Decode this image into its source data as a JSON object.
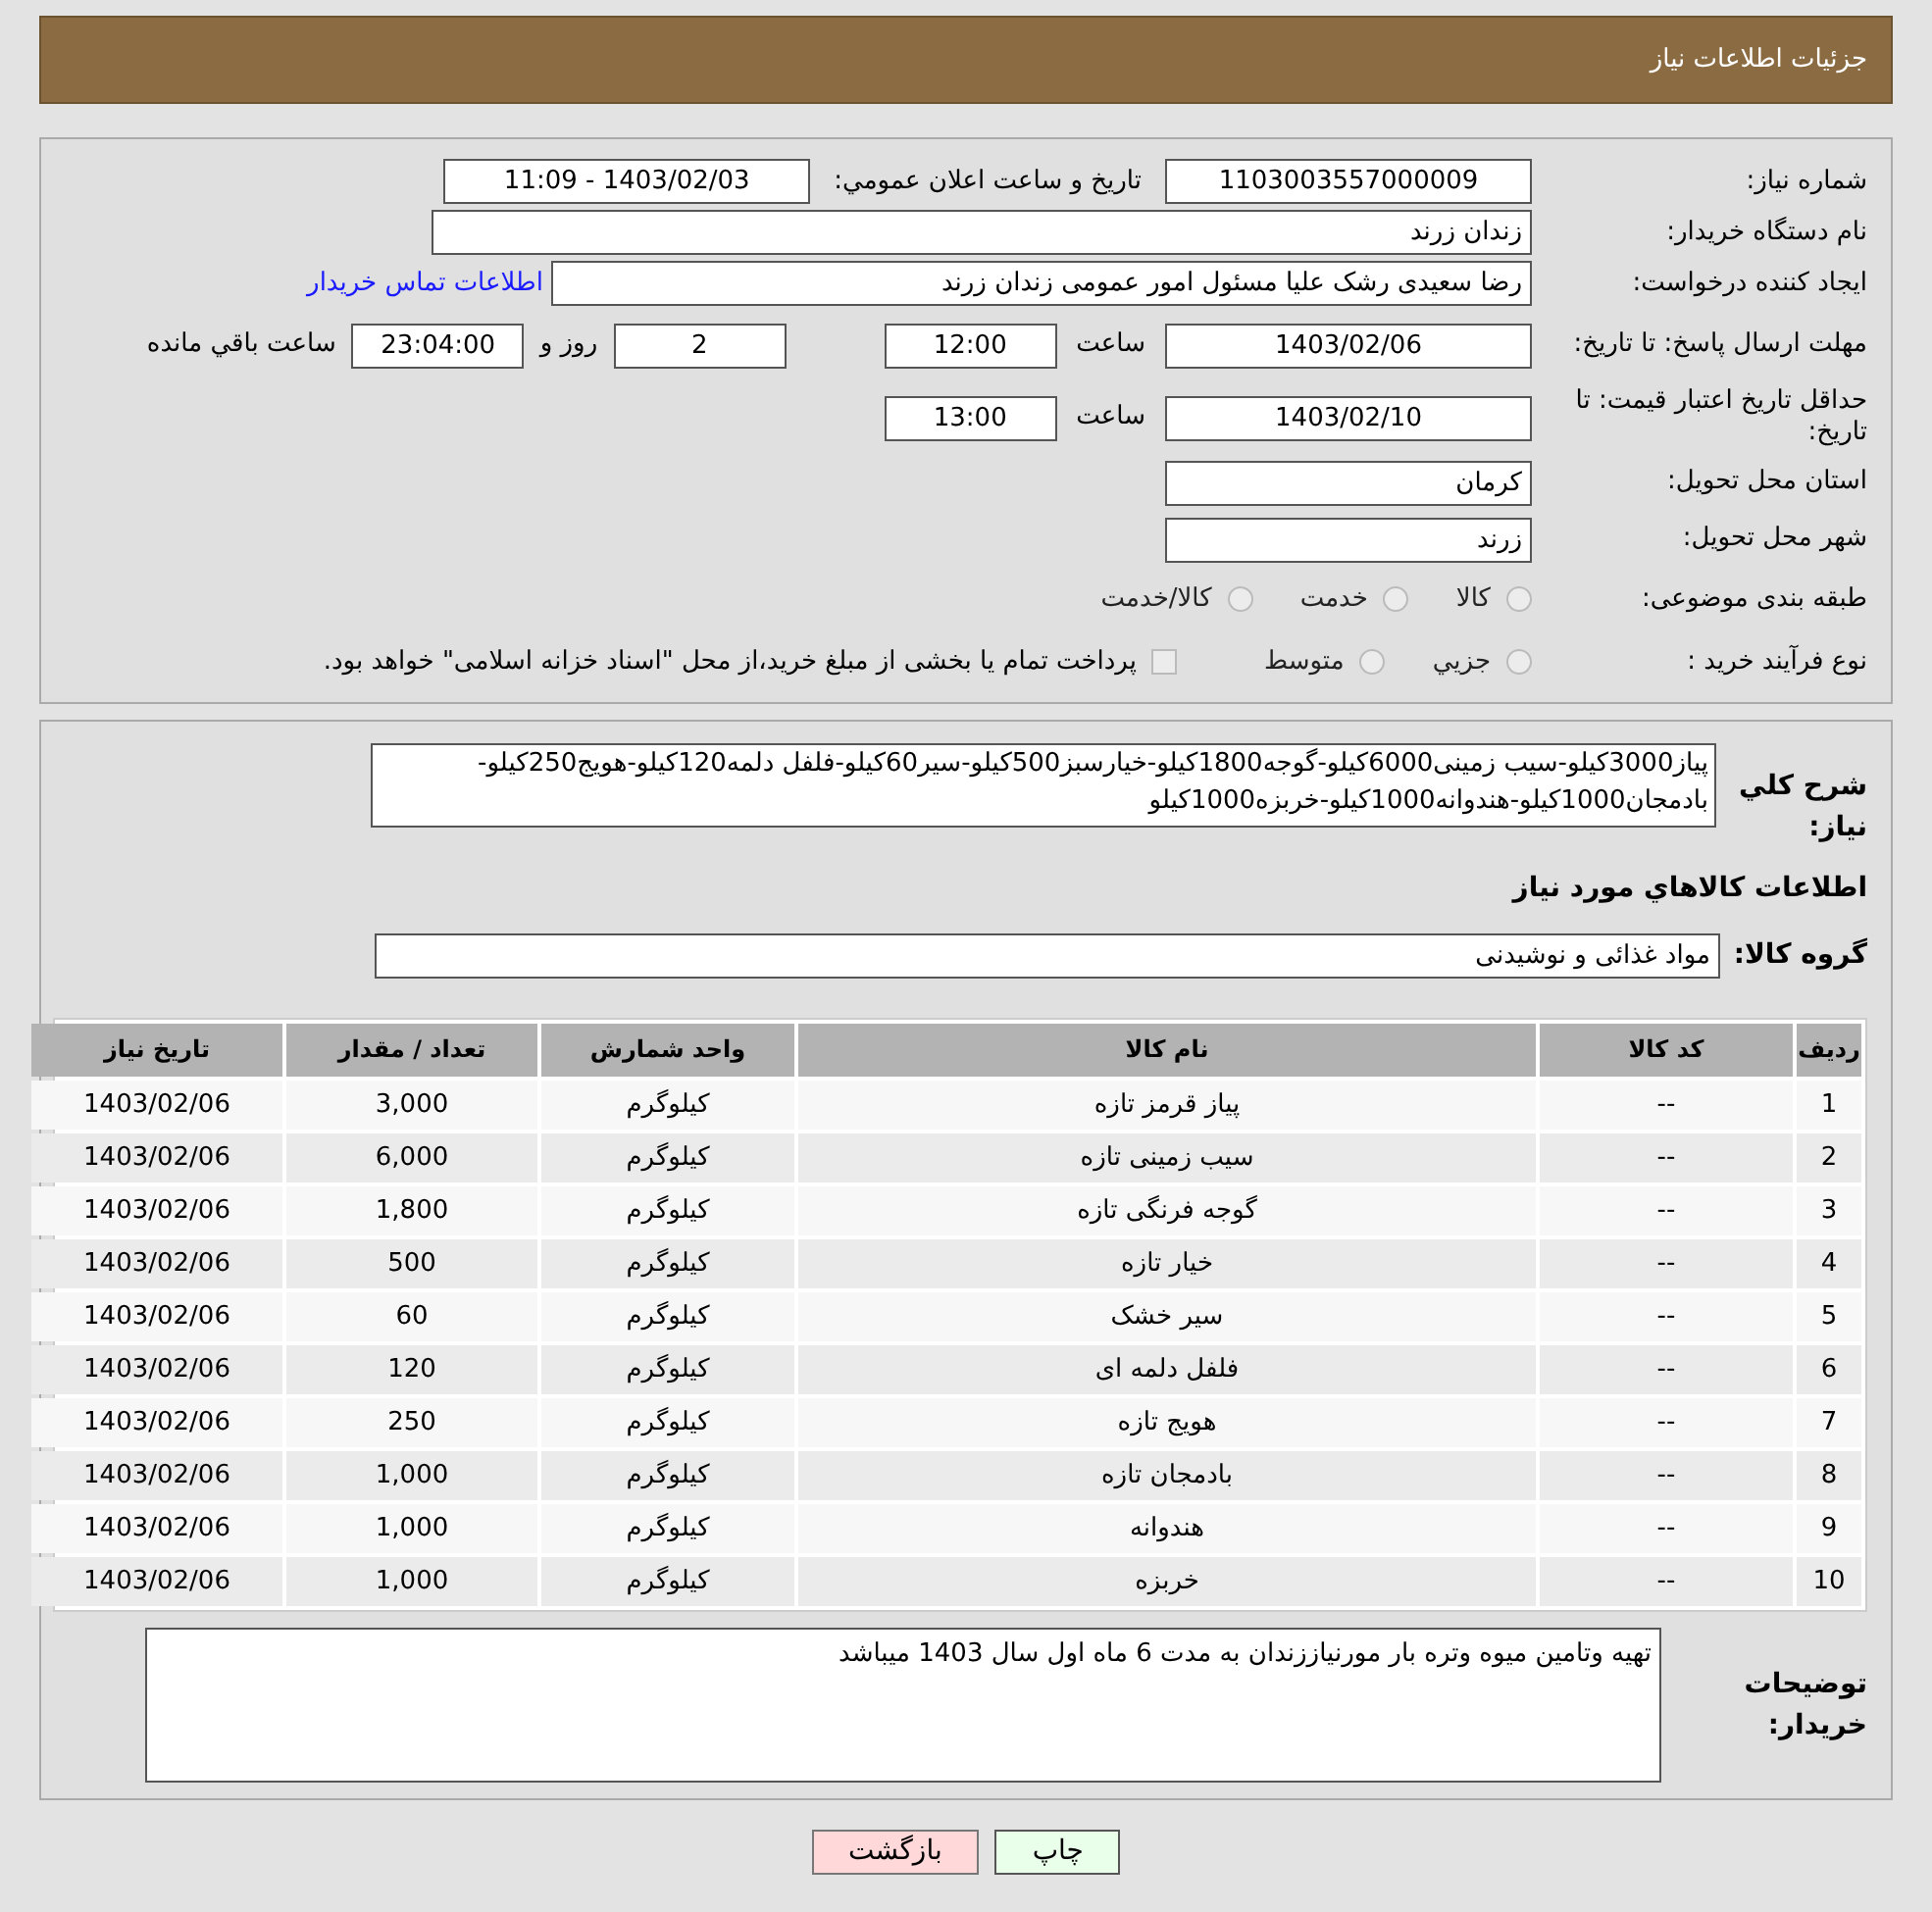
{
  "header": {
    "title": "جزئیات اطلاعات نیاز"
  },
  "details": {
    "need_number": {
      "label": "شماره نیاز:",
      "value": "1103003557000009"
    },
    "announce": {
      "label": "تاريخ و ساعت اعلان عمومي:",
      "value": "1403/02/03 - 11:09"
    },
    "buyer": {
      "label": "نام دستگاه خریدار:",
      "value": "زندان زرند"
    },
    "requester": {
      "label": "ایجاد کننده درخواست:",
      "value": "رضا سعیدی رشک علیا مسئول امور عمومی زندان زرند",
      "link": "اطلاعات تماس خریدار"
    },
    "deadline": {
      "label": "مهلت ارسال پاسخ: تا تاریخ:",
      "date": "1403/02/06",
      "time_label": "ساعت",
      "time": "12:00",
      "days": "2",
      "days_label": "روز و",
      "remaining": "23:04:00",
      "remaining_label": "ساعت باقي مانده"
    },
    "validity": {
      "label": "حداقل تاریخ اعتبار قیمت: تا تاریخ:",
      "date": "1403/02/10",
      "time_label": "ساعت",
      "time": "13:00"
    },
    "province": {
      "label": "استان محل تحویل:",
      "value": "کرمان"
    },
    "city": {
      "label": "شهر محل تحویل:",
      "value": "زرند"
    },
    "category": {
      "label": "طبقه بندی موضوعی:",
      "options": [
        {
          "label": "کالا",
          "selected": false
        },
        {
          "label": "خدمت",
          "selected": false
        },
        {
          "label": "کالا/خدمت",
          "selected": false
        }
      ]
    },
    "process": {
      "label": "نوع فرآیند خرید :",
      "options": [
        {
          "label": "جزيي",
          "selected": false
        },
        {
          "label": "متوسط",
          "selected": false
        }
      ],
      "treasury": {
        "label": "پرداخت تمام یا بخشی از مبلغ خرید،از محل \"اسناد خزانه اسلامی\" خواهد بود.",
        "checked": false
      }
    }
  },
  "summary": {
    "label": "شرح کلي نیاز:",
    "value": "پیاز3000کیلو-سیب زمینی6000کیلو-گوجه1800کیلو-خیارسبز500کیلو-سیر60کیلو-فلفل دلمه120کیلو-هویج250کیلو-بادمجان1000کیلو-هندوانه1000کیلو-خربزه1000کیلو"
  },
  "goods_heading": "اطلاعات كالاهاي مورد نياز",
  "goods_group": {
    "label": "گروه کالا:",
    "value": "مواد غذائی و نوشیدنی"
  },
  "table": {
    "columns": [
      "ردیف",
      "کد کالا",
      "نام کالا",
      "واحد شمارش",
      "تعداد / مقدار",
      "تاریخ نیاز"
    ],
    "rows": [
      [
        "1",
        "--",
        "پیاز قرمز تازه",
        "کیلوگرم",
        "3,000",
        "1403/02/06"
      ],
      [
        "2",
        "--",
        "سیب زمینی تازه",
        "کیلوگرم",
        "6,000",
        "1403/02/06"
      ],
      [
        "3",
        "--",
        "گوجه فرنگی تازه",
        "کیلوگرم",
        "1,800",
        "1403/02/06"
      ],
      [
        "4",
        "--",
        "خیار تازه",
        "کیلوگرم",
        "500",
        "1403/02/06"
      ],
      [
        "5",
        "--",
        "سیر خشک",
        "کیلوگرم",
        "60",
        "1403/02/06"
      ],
      [
        "6",
        "--",
        "فلفل دلمه ای",
        "کیلوگرم",
        "120",
        "1403/02/06"
      ],
      [
        "7",
        "--",
        "هویج تازه",
        "کیلوگرم",
        "250",
        "1403/02/06"
      ],
      [
        "8",
        "--",
        "بادمجان تازه",
        "کیلوگرم",
        "1,000",
        "1403/02/06"
      ],
      [
        "9",
        "--",
        "هندوانه",
        "کیلوگرم",
        "1,000",
        "1403/02/06"
      ],
      [
        "10",
        "--",
        "خربزه",
        "کیلوگرم",
        "1,000",
        "1403/02/06"
      ]
    ]
  },
  "buyer_notes": {
    "label": "توضیحات خریدار:",
    "value": "تهیه وتامین میوه وتره بار مورنیاززندان به مدت 6 ماه اول سال 1403 میباشد"
  },
  "buttons": [
    {
      "label": "چاپ",
      "kind": "print"
    },
    {
      "label": "بازگشت",
      "kind": "back"
    }
  ]
}
